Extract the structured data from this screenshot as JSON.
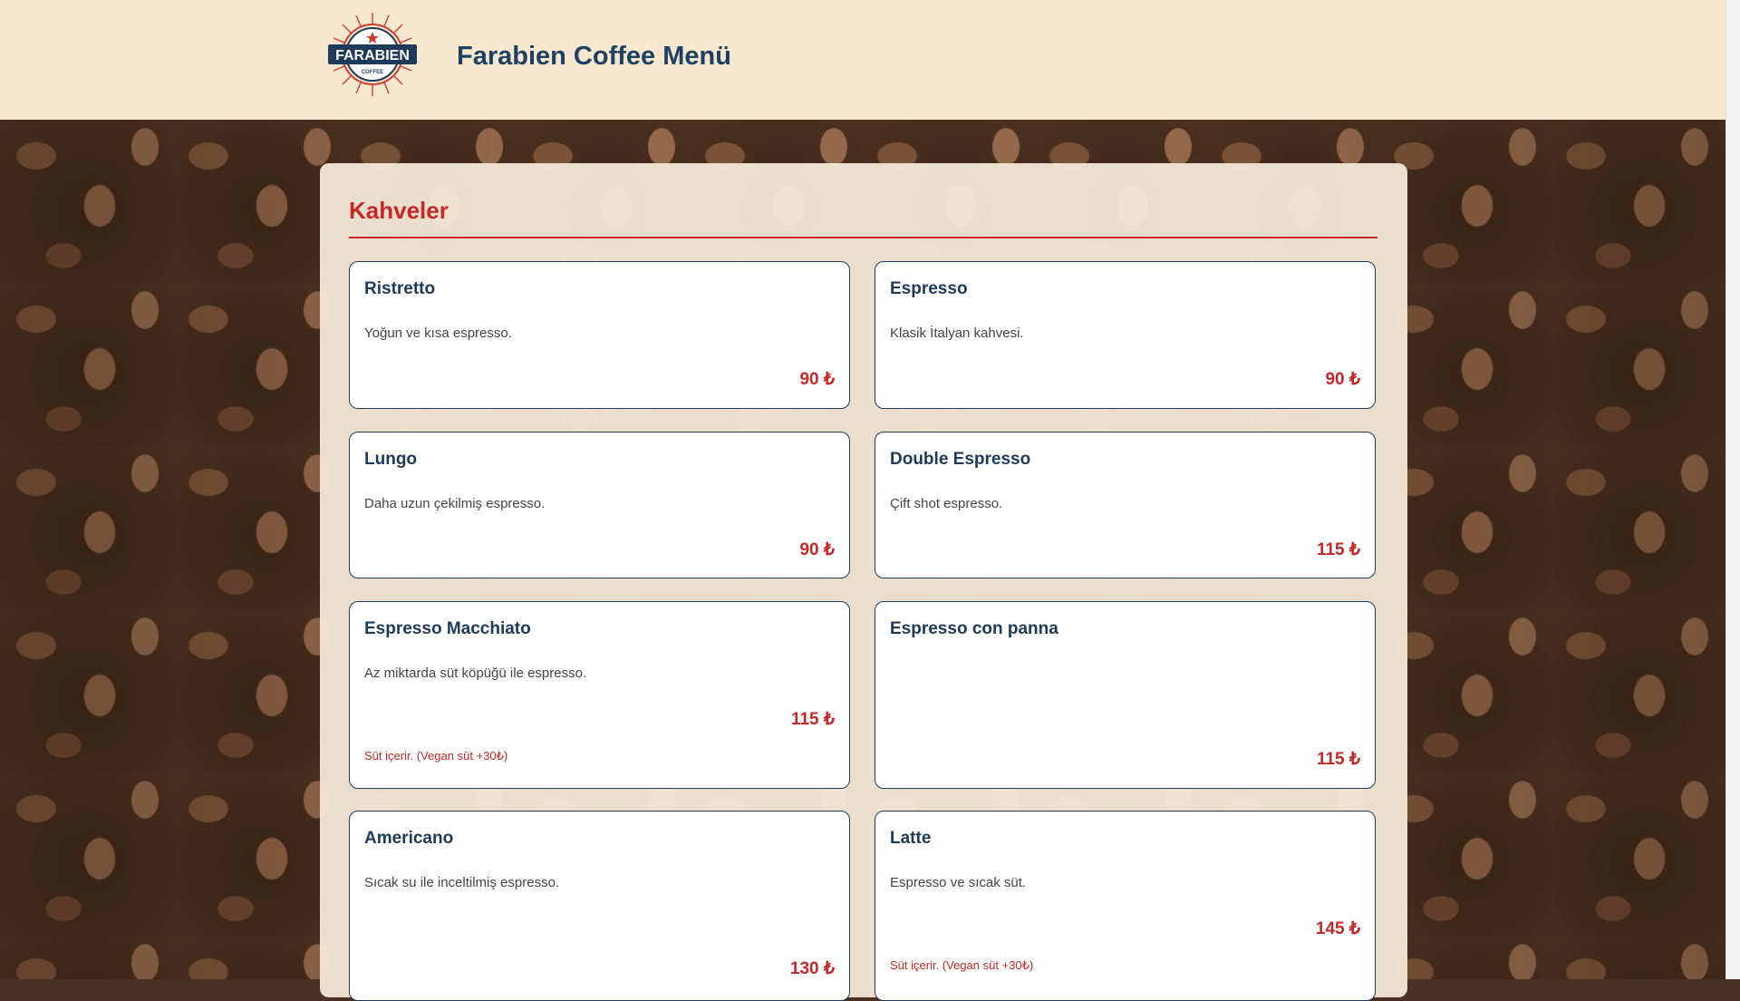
{
  "header": {
    "logo_text": "FARABIEN",
    "logo_sub": "COFFEE",
    "title": "Farabien Coffee Menü"
  },
  "section": {
    "title": "Kahveler"
  },
  "items": [
    {
      "name": "Ristretto",
      "desc": "Yoğun ve kısa espresso.",
      "price": "90 ₺",
      "note": ""
    },
    {
      "name": "Espresso",
      "desc": "Klasik İtalyan kahvesi.",
      "price": "90 ₺",
      "note": ""
    },
    {
      "name": "Lungo",
      "desc": "Daha uzun çekilmiş espresso.",
      "price": "90 ₺",
      "note": ""
    },
    {
      "name": "Double Espresso",
      "desc": "Çift shot espresso.",
      "price": "115 ₺",
      "note": ""
    },
    {
      "name": "Espresso Macchiato",
      "desc": "Az miktarda süt köpüğü ile espresso.",
      "price": "115 ₺",
      "note": "Süt içerir. (Vegan süt +30₺)"
    },
    {
      "name": "Espresso con panna",
      "desc": "",
      "price": "115 ₺",
      "note": ""
    },
    {
      "name": "Americano",
      "desc": "Sıcak su ile inceltilmiş espresso.",
      "price": "130 ₺",
      "note": ""
    },
    {
      "name": "Latte",
      "desc": "Espresso ve sıcak süt.",
      "price": "145 ₺",
      "note": "Süt içerir. (Vegan süt +30₺)"
    }
  ],
  "colors": {
    "brand_navy": "#1e3a5a",
    "accent_red": "#c62828",
    "header_bg": "#f6e8cf"
  }
}
